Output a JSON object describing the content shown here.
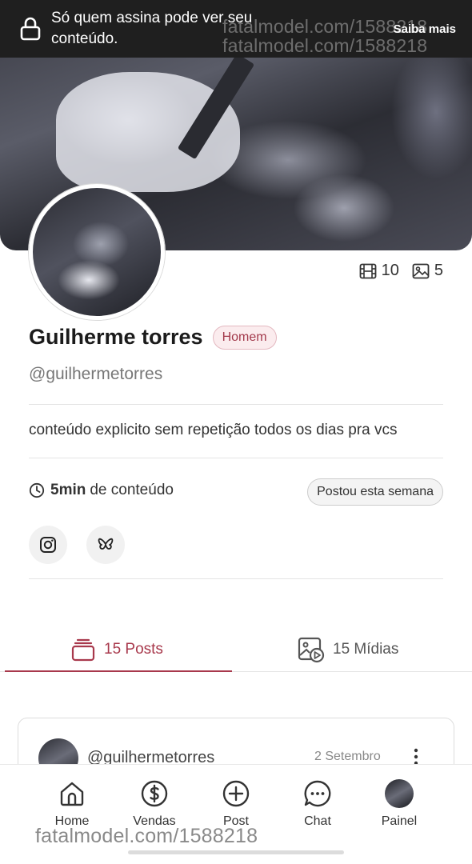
{
  "notice": {
    "text": "Só quem assina pode ver seu conteúdo.",
    "cta": "Saiba mais"
  },
  "watermark": "fatalmodel.com/1588218",
  "profile": {
    "name": "Guilherme torres",
    "badge": "Homem",
    "handle": "@guilhermetorres",
    "bio": "conteúdo explicito sem repetição todos os dias pra vcs",
    "duration_value": "5min",
    "duration_suffix": "de conteúdo",
    "posted_badge": "Postou esta semana",
    "videos_count": "10",
    "photos_count": "5"
  },
  "tabs": [
    {
      "label": "15 Posts",
      "active": true
    },
    {
      "label": "15 Mídias",
      "active": false
    }
  ],
  "post": {
    "handle": "@guilhermetorres",
    "date": "2 Setembro"
  },
  "nav": [
    {
      "label": "Home",
      "icon": "home-icon"
    },
    {
      "label": "Vendas",
      "icon": "dollar-icon"
    },
    {
      "label": "Post",
      "icon": "plus-circle-icon"
    },
    {
      "label": "Chat",
      "icon": "chat-icon"
    },
    {
      "label": "Painel",
      "icon": "avatar"
    }
  ],
  "colors": {
    "accent": "#a8394c",
    "notice_bg": "#1f1f1f",
    "badge_bg": "#fbecee"
  }
}
